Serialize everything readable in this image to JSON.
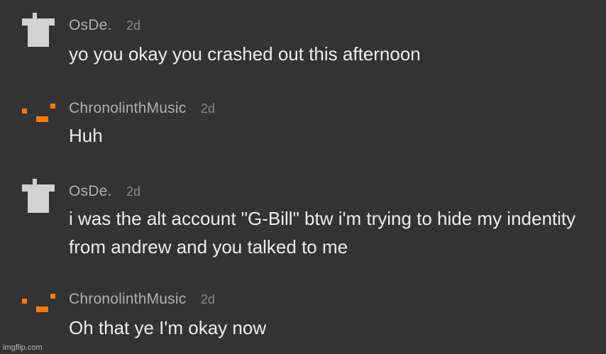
{
  "comments": [
    {
      "username": "OsDe.",
      "time": "2d",
      "avatar_icon": "gray-t-shirt-pixel-icon",
      "text": "yo you okay you crashed out this afternoon"
    },
    {
      "username": "ChronolinthMusic",
      "time": "2d",
      "avatar_icon": "orange-pixel-blocks-icon",
      "text": "Huh"
    },
    {
      "username": "OsDe.",
      "time": "2d",
      "avatar_icon": "gray-t-shirt-pixel-icon",
      "text": "i was the alt account \"G-Bill\" btw i'm trying to hide my indentity from andrew and you talked to me"
    },
    {
      "username": "ChronolinthMusic",
      "time": "2d",
      "avatar_icon": "orange-pixel-blocks-icon",
      "text": "Oh that ye I'm okay now"
    }
  ],
  "watermark": "imgflip.com",
  "colors": {
    "background": "#333333",
    "avatar_gray": "#d2d2d2",
    "avatar_orange": "#ff7a00",
    "username": "#b0b0b0",
    "text": "#ececec"
  }
}
